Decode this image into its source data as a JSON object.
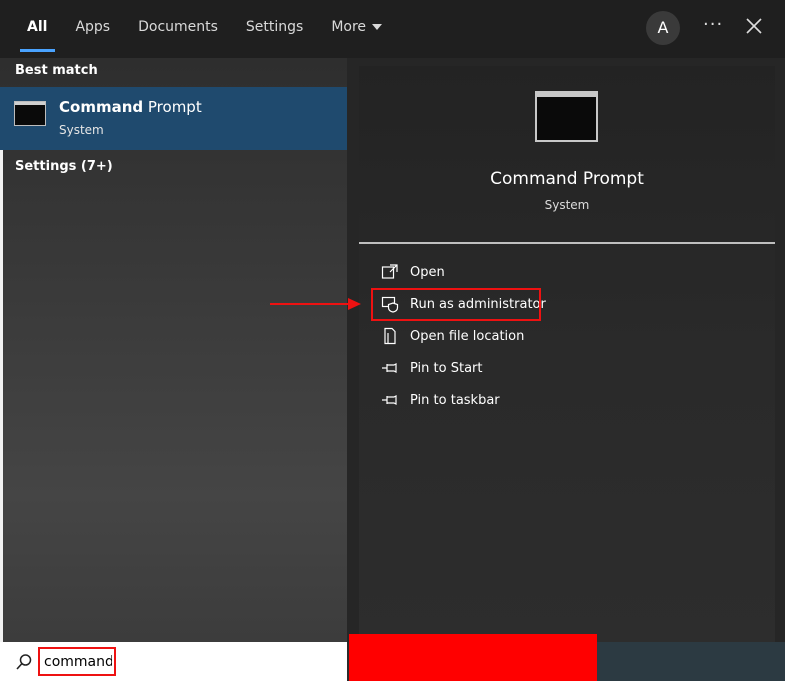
{
  "header": {
    "tabs": [
      {
        "label": "All",
        "active": true
      },
      {
        "label": "Apps"
      },
      {
        "label": "Documents"
      },
      {
        "label": "Settings"
      },
      {
        "label": "More"
      }
    ],
    "avatar_letter": "A",
    "more_options": "···"
  },
  "left": {
    "best_match_label": "Best match",
    "best_match": {
      "title_bold": "Command",
      "title_rest": " Prompt",
      "subtitle": "System"
    },
    "settings_label": "Settings (7+)"
  },
  "right": {
    "app_title": "Command Prompt",
    "app_subtitle": "System",
    "actions": [
      {
        "label": "Open",
        "icon": "open-icon"
      },
      {
        "label": "Run as administrator",
        "icon": "shield-icon"
      },
      {
        "label": "Open file location",
        "icon": "file-location-icon"
      },
      {
        "label": "Pin to Start",
        "icon": "pin-icon"
      },
      {
        "label": "Pin to taskbar",
        "icon": "pin-icon"
      }
    ]
  },
  "search": {
    "value": "command"
  },
  "colors": {
    "accent": "#4aa3ff",
    "selected_bg": "#1f4a6e",
    "annotation_red": "#ee1111"
  }
}
